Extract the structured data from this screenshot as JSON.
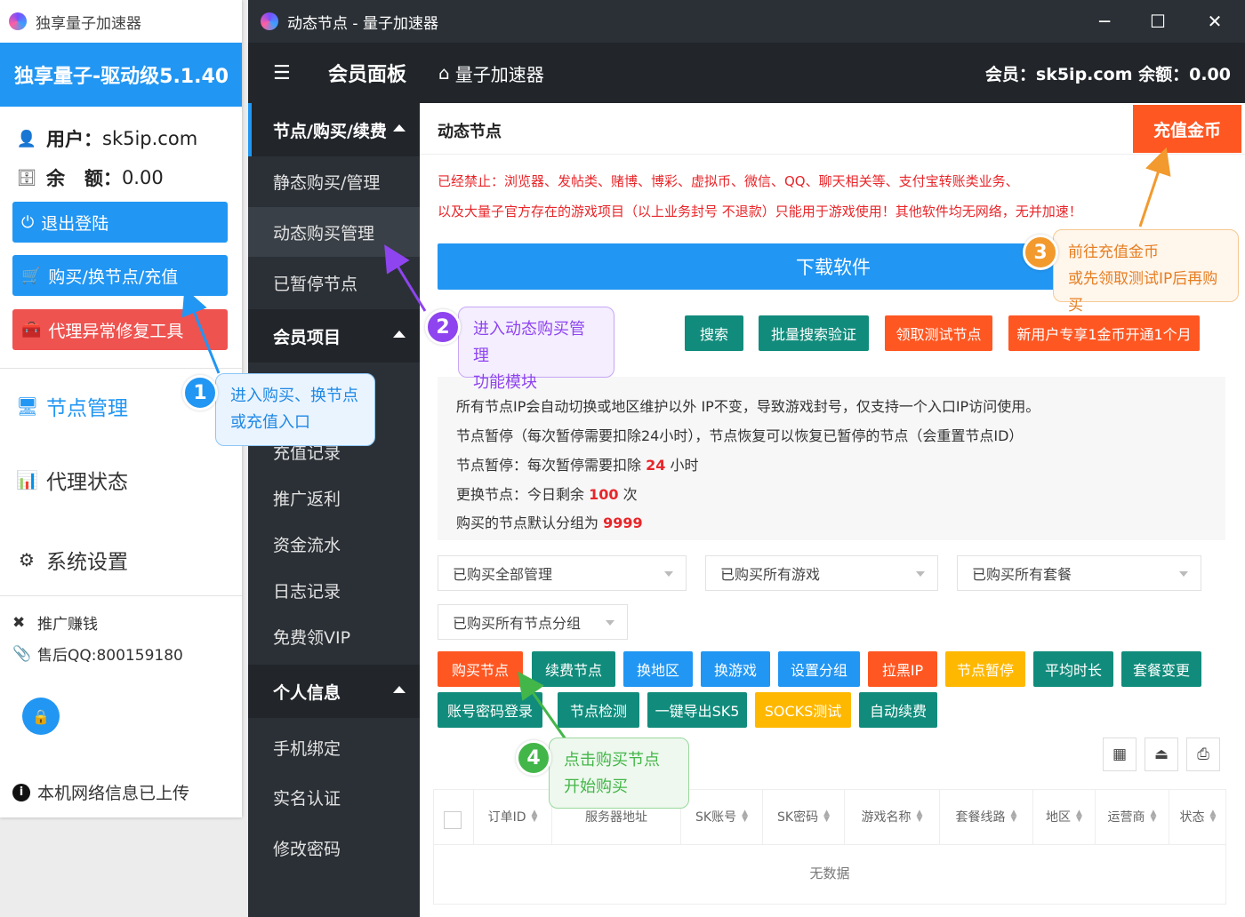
{
  "left_window": {
    "title": "独享量子加速器",
    "version": "独享量子-驱动级5.1.40",
    "user_label": "用户：",
    "user_value": "sk5ip.com",
    "balance_label": "余   额：",
    "balance_value": "0.00",
    "btn_logout": "退出登陆",
    "btn_buy": "购买/换节点/充值",
    "btn_repair": "代理异常修复工具",
    "nav": [
      "节点管理",
      "代理状态",
      "系统设置"
    ],
    "promo": "推广赚钱",
    "support": "售后QQ:800159180",
    "upload_status": "本机网络信息已上传"
  },
  "main_window": {
    "title": "动态节点 - 量子加速器",
    "controls": [
      "─",
      "☐",
      "✕"
    ]
  },
  "topbar": {
    "panel": "会员面板",
    "home": "量子加速器",
    "member_info": "会员：sk5ip.com 余额：0.00"
  },
  "sidebar": {
    "group1": "节点/购买/续费",
    "group1_items": [
      "静态购买/管理",
      "动态购买管理",
      "已暂停节点"
    ],
    "group2": "会员项目",
    "group2_items": [
      "充值记录",
      "推广返利",
      "资金流水",
      "日志记录",
      "免费领VIP"
    ],
    "group3": "个人信息",
    "group3_items": [
      "手机绑定",
      "实名认证",
      "修改密码"
    ]
  },
  "content": {
    "page_title": "动态节点",
    "recharge_btn": "充值金币",
    "warning_1": "已经禁止：浏览器、发帖类、赌博、博彩、虚拟币、微信、QQ、聊天相关等、支付宝转账类业务、",
    "warning_2": "以及大量子官方存在的游戏项目（以上业务封号 不退款）只能用于游戏使用！其他软件均无网络，无并加速！",
    "download_btn": "下载软件",
    "action_buttons": [
      "搜索",
      "批量搜索验证",
      "领取测试节点",
      "新用户专享1金币开通1个月"
    ],
    "notice": {
      "line1": "所有节点IP会自动切换或地区维护以外 IP不变，导致游戏封号，仅支持一个入口IP访问使用。",
      "line2": "节点暂停（每次暂停需要扣除24小时），节点恢复可以恢复已暂停的节点（会重置节点ID）",
      "line3_pre": "节点暂停：每次暂停需要扣除 ",
      "line3_num": "24",
      "line3_post": " 小时",
      "line4_pre": "更换节点：今日剩余 ",
      "line4_num": "100",
      "line4_post": " 次",
      "line5_pre": "购买的节点默认分组为 ",
      "line5_num": "9999"
    },
    "filters": [
      "已购买全部管理",
      "已购买所有游戏",
      "已购买所有套餐",
      "已购买所有节点分组"
    ],
    "buttons_row1": [
      "购买节点",
      "续费节点",
      "换地区",
      "换游戏",
      "设置分组",
      "拉黑IP",
      "节点暂停",
      "平均时长",
      "套餐变更"
    ],
    "buttons_row2": [
      "账号密码登录",
      "节点检测",
      "一键导出SK5",
      "SOCKS测试",
      "自动续费"
    ],
    "table_headers": [
      "订单ID",
      "服务器地址",
      "SK账号",
      "SK密码",
      "游戏名称",
      "套餐线路",
      "地区",
      "运营商",
      "状态"
    ],
    "empty_text": "无数据"
  },
  "callouts": {
    "c1_num": "1",
    "c1_l1": "进入购买、换节点",
    "c1_l2": "或充值入口",
    "c2_num": "2",
    "c2_l1": "进入动态购买管理",
    "c2_l2": "功能模块",
    "c3_num": "3",
    "c3_l1": "前往充值金币",
    "c3_l2": "或先领取测试IP后再购买",
    "c4_num": "4",
    "c4_l1": "点击购买节点",
    "c4_l2": "开始购买"
  },
  "colors": {
    "primary": "#2196f3",
    "teal": "#118c7c",
    "orange": "#ff5722",
    "yellow": "#ffb800",
    "red_text": "#e8262a",
    "dark_sidebar": "#2b3036"
  }
}
